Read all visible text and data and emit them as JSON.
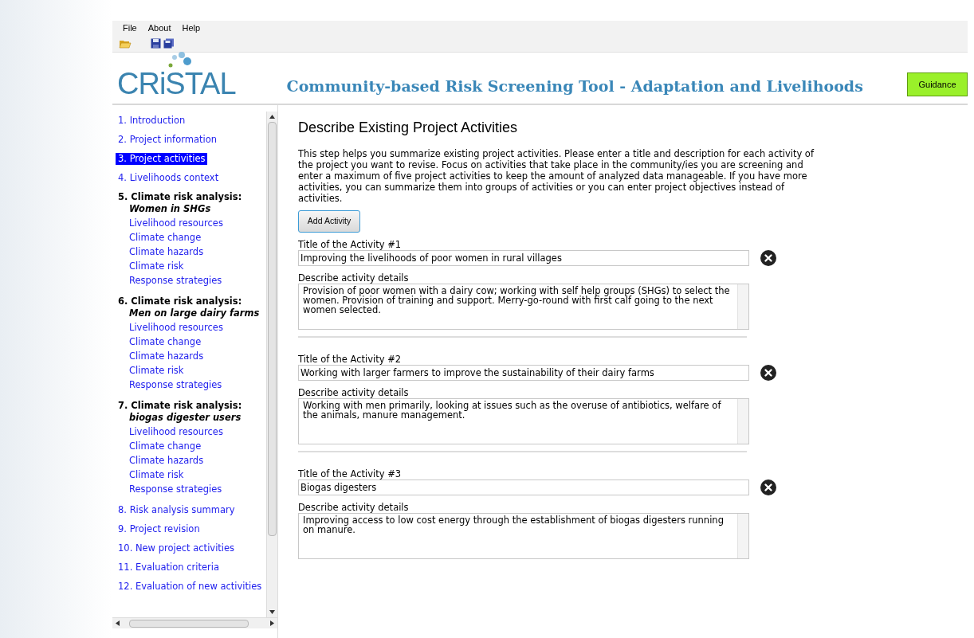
{
  "menu": [
    "File",
    "About",
    "Help"
  ],
  "header": {
    "logo": "CRiSTAL",
    "title": "Community-based Risk Screening Tool - Adaptation and Livelihoods",
    "guidance_button": "Guidance"
  },
  "sidebar": {
    "items": [
      {
        "kind": "link",
        "label": "1. Introduction",
        "selected": false
      },
      {
        "kind": "link",
        "label": "2. Project information",
        "selected": false
      },
      {
        "kind": "link",
        "label": "3. Project activities",
        "selected": true
      },
      {
        "kind": "link",
        "label": "4. Livelihoods context",
        "selected": false
      },
      {
        "kind": "group",
        "label": "5. Climate risk analysis:",
        "subtitle": "Women in SHGs",
        "children": [
          {
            "label": "Livelihood resources"
          },
          {
            "label": "Climate change"
          },
          {
            "label": "Climate hazards"
          },
          {
            "label": "Climate risk"
          },
          {
            "label": "Response strategies"
          }
        ]
      },
      {
        "kind": "group",
        "label": "6. Climate risk analysis:",
        "subtitle": "Men on large dairy farms",
        "children": [
          {
            "label": "Livelihood resources"
          },
          {
            "label": "Climate change"
          },
          {
            "label": "Climate hazards"
          },
          {
            "label": "Climate risk"
          },
          {
            "label": "Response strategies"
          }
        ]
      },
      {
        "kind": "group",
        "label": "7. Climate risk analysis:",
        "subtitle": "biogas digester users",
        "children": [
          {
            "label": "Livelihood resources"
          },
          {
            "label": "Climate change"
          },
          {
            "label": "Climate hazards"
          },
          {
            "label": "Climate risk"
          },
          {
            "label": "Response strategies"
          }
        ]
      },
      {
        "kind": "link",
        "label": "8. Risk analysis summary",
        "selected": false
      },
      {
        "kind": "link",
        "label": "9. Project revision",
        "selected": false
      },
      {
        "kind": "link",
        "label": "10. New project activities",
        "selected": false
      },
      {
        "kind": "link",
        "label": "11. Evaluation criteria",
        "selected": false
      },
      {
        "kind": "link",
        "label": "12. Evaluation of new activities",
        "selected": false
      }
    ]
  },
  "content": {
    "heading": "Describe Existing Project Activities",
    "intro": "This step helps you summarize existing project activities. Please enter a title and description for each activity of the project you want to revise. Focus on activities that take place in the community/ies you are screening and enter a maximum of five project activities to keep the amount of analyzed data manageable. If you have more activities, you can summarize them into groups of activities or you can enter project objectives instead of activities.",
    "add_button": "Add Activity",
    "activities": [
      {
        "title_label": "Title of the Activity #1",
        "title": "Improving the livelihoods of poor women in rural villages",
        "details_label": "Describe activity details",
        "details": "Provision of poor women with a dairy cow; working with self help groups (SHGs) to select the women. Provision of training and support. Merry-go-round with first calf going to the next women selected."
      },
      {
        "title_label": "Title of the Activity #2",
        "title": "Working with larger farmers to improve the sustainability of their dairy farms",
        "details_label": "Describe activity details",
        "details": "Working with men primarily, looking at issues such as the overuse of antibiotics, welfare of the animals, manure management."
      },
      {
        "title_label": "Title of the Activity #3",
        "title": "Biogas digesters",
        "details_label": "Describe activity details",
        "details": "Improving access to low cost energy through the establishment of biogas digesters running on manure."
      }
    ]
  }
}
